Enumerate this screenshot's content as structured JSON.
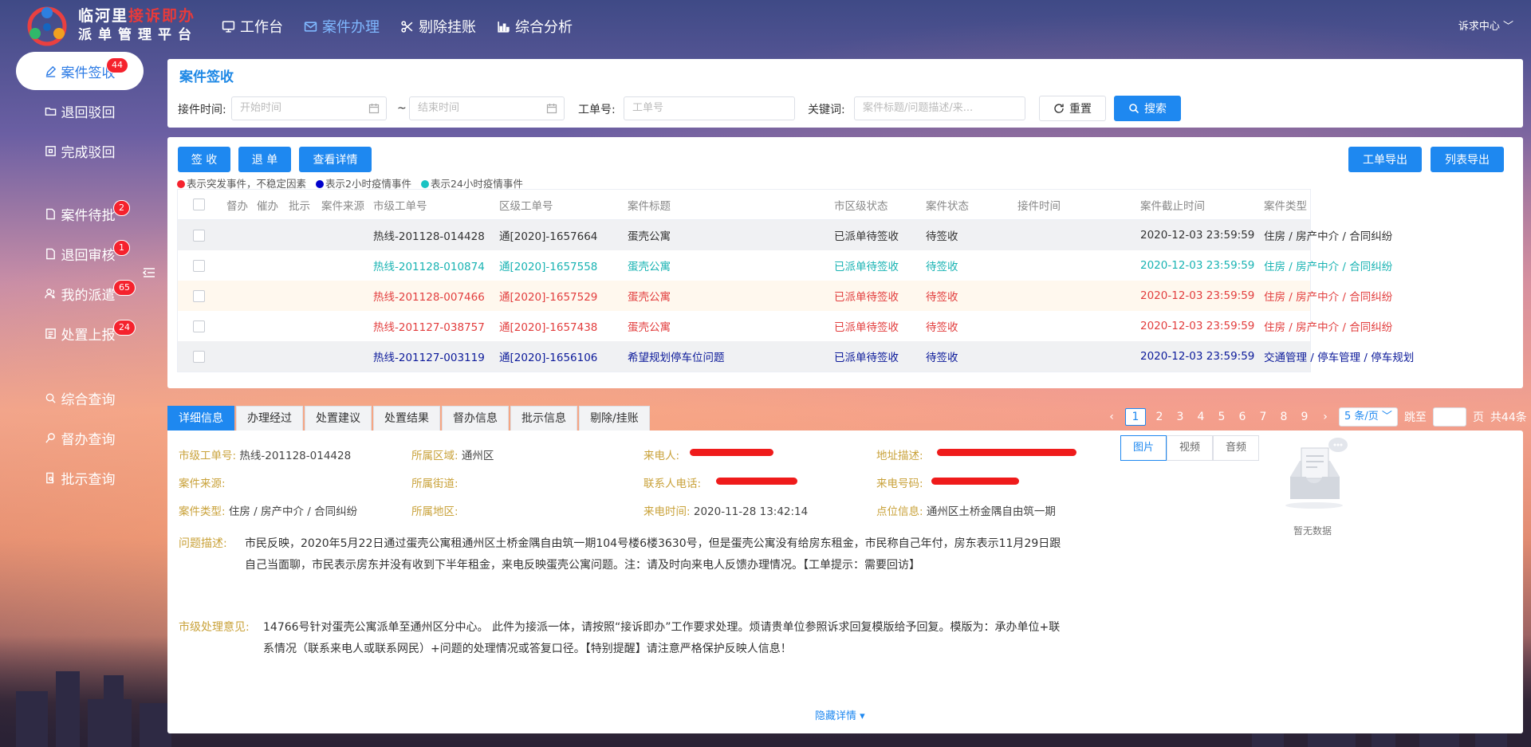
{
  "brand": {
    "line1_a": "临河里",
    "line1_b": "接诉即办",
    "line2": "派单管理平台"
  },
  "nav": [
    {
      "label": "工作台",
      "icon": "monitor-icon"
    },
    {
      "label": "案件办理",
      "icon": "mail-icon",
      "active": true
    },
    {
      "label": "剔除挂账",
      "icon": "scissors-icon"
    },
    {
      "label": "综合分析",
      "icon": "chart-icon"
    }
  ],
  "user_menu": "诉求中心",
  "sidebar": [
    {
      "label": "案件签收",
      "badge": "44",
      "icon": "edit-icon"
    },
    {
      "label": "退回驳回",
      "badge": "",
      "icon": "folder-icon"
    },
    {
      "label": "完成驳回",
      "badge": "",
      "icon": "check-square-icon"
    },
    {
      "label": "案件待批",
      "badge": "2",
      "icon": "document-icon"
    },
    {
      "label": "退回审核",
      "badge": "1",
      "icon": "document-icon"
    },
    {
      "label": "我的派遣",
      "badge": "65",
      "icon": "users-icon"
    },
    {
      "label": "处置上报",
      "badge": "24",
      "icon": "report-icon"
    },
    {
      "label": "综合查询",
      "badge": "",
      "icon": "search-icon"
    },
    {
      "label": "督办查询",
      "badge": "",
      "icon": "search-person-icon"
    },
    {
      "label": "批示查询",
      "badge": "",
      "icon": "doc-search-icon"
    }
  ],
  "search": {
    "title": "案件签收",
    "time_label": "接件时间:",
    "start_placeholder": "开始时间",
    "range_sep": "~",
    "end_placeholder": "结束时间",
    "order_label": "工单号:",
    "order_placeholder": "工单号",
    "keyword_label": "关键词:",
    "keyword_placeholder": "案件标题/问题描述/来...",
    "reset": "重置",
    "search": "搜索"
  },
  "actions": {
    "sign": "签 收",
    "return": "退 单",
    "detail": "查看详情",
    "export_order": "工单导出",
    "export_list": "列表导出"
  },
  "legend": [
    {
      "color": "#f5222d",
      "text": "表示突发事件，不稳定因素"
    },
    {
      "color": "#0000cc",
      "text": "表示2小时疫情事件"
    },
    {
      "color": "#19c3c3",
      "text": "表示24小时疫情事件"
    }
  ],
  "table": {
    "headers": [
      "督办",
      "催办",
      "批示",
      "案件来源",
      "市级工单号",
      "区级工单号",
      "案件标题",
      "市区级状态",
      "案件状态",
      "接件时间",
      "案件截止时间",
      "案件类型"
    ],
    "rows": [
      {
        "style": "r-gray",
        "cells": [
          "",
          "",
          "",
          "",
          "热线-201128-014428",
          "通[2020]-1657664",
          "蛋壳公寓",
          "已派单待签收",
          "待签收",
          "",
          "2020-12-03 23:59:59",
          "住房 / 房产中介 / 合同纠纷"
        ]
      },
      {
        "style": "r-teal",
        "cells": [
          "",
          "",
          "",
          "",
          "热线-201128-010874",
          "通[2020]-1657558",
          "蛋壳公寓",
          "已派单待签收",
          "待签收",
          "",
          "2020-12-03 23:59:59",
          "住房 / 房产中介 / 合同纠纷"
        ]
      },
      {
        "style": "r-red1",
        "cells": [
          "",
          "",
          "",
          "",
          "热线-201128-007466",
          "通[2020]-1657529",
          "蛋壳公寓",
          "已派单待签收",
          "待签收",
          "",
          "2020-12-03 23:59:59",
          "住房 / 房产中介 / 合同纠纷"
        ]
      },
      {
        "style": "r-red2",
        "cells": [
          "",
          "",
          "",
          "",
          "热线-201127-038757",
          "通[2020]-1657438",
          "蛋壳公寓",
          "已派单待签收",
          "待签收",
          "",
          "2020-12-03 23:59:59",
          "住房 / 房产中介 / 合同纠纷"
        ]
      },
      {
        "style": "r-navy",
        "cells": [
          "",
          "",
          "",
          "",
          "热线-201127-003119",
          "通[2020]-1656106",
          "希望规划停车位问题",
          "已派单待签收",
          "待签收",
          "",
          "2020-12-03 23:59:59",
          "交通管理 / 停车管理 / 停车规划"
        ]
      }
    ]
  },
  "tabs": [
    "详细信息",
    "办理经过",
    "处置建议",
    "处置结果",
    "督办信息",
    "批示信息",
    "剔除/挂账"
  ],
  "pagination": {
    "prev": "‹",
    "pages": [
      "1",
      "2",
      "3",
      "4",
      "5",
      "6",
      "7",
      "8",
      "9"
    ],
    "next": "›",
    "page_size": "5 条/页",
    "jump_to": "跳至",
    "page_unit": "页",
    "total": "共44条"
  },
  "detail": {
    "city_order_label": "市级工单号:",
    "city_order": "热线-201128-014428",
    "area_label": "所属区域:",
    "area": "通州区",
    "caller_label": "来电人:",
    "address_label": "地址描述:",
    "source_label": "案件来源:",
    "street_label": "所属街道:",
    "contact_label": "联系人电话:",
    "phone_label": "来电号码:",
    "type_label": "案件类型:",
    "type": "住房 / 房产中介 / 合同纠纷",
    "region_label": "所属地区:",
    "call_time_label": "来电时间:",
    "call_time": "2020-11-28 13:42:14",
    "point_label": "点位信息:",
    "point": "通州区土桥金隅自由筑一期",
    "problem_label": "问题描述:",
    "problem_line1": "市民反映，2020年5月22日通过蛋壳公寓租通州区土桥金隅自由筑一期104号楼6楼3630号，但是蛋壳公寓没有给房东租金，市民称自己年付，房东表示11月29日跟",
    "problem_line2": "自己当面聊，市民表示房东并没有收到下半年租金，来电反映蛋壳公寓问题。注：请及时向来电人反馈办理情况。【工单提示：需要回访】",
    "opinion_label": "市级处理意见:",
    "opinion_line1": "14766号针对蛋壳公寓派单至通州区分中心。 此件为接派一体，请按照“接诉即办”工作要求处理。烦请贵单位参照诉求回复模版给予回复。模版为：承办单位+联",
    "opinion_line2": "系情况（联系来电人或联系网民）+问题的处理情况或答复口径。【特别提醒】请注意严格保护反映人信息！"
  },
  "media": {
    "tabs": [
      "图片",
      "视频",
      "音频"
    ],
    "empty": "暂无数据"
  },
  "hide_detail": "隐藏详情"
}
